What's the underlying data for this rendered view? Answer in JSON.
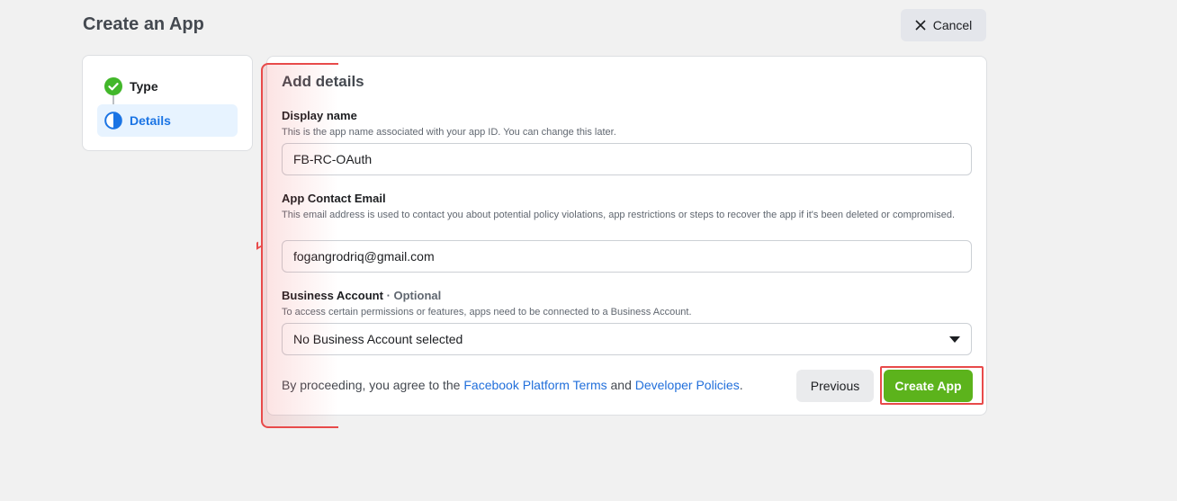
{
  "header": {
    "title": "Create an App",
    "cancel_label": "Cancel"
  },
  "steps": [
    {
      "label": "Type",
      "status": "complete",
      "icon": "check-circle-icon"
    },
    {
      "label": "Details",
      "status": "current",
      "icon": "half-circle-icon"
    }
  ],
  "form": {
    "title": "Add details",
    "display_name": {
      "label": "Display name",
      "help": "This is the app name associated with your app ID. You can change this later.",
      "value": "FB-RC-OAuth"
    },
    "contact_email": {
      "label": "App Contact Email",
      "help": "This email address is used to contact you about potential policy violations, app restrictions or steps to recover the app if it's been deleted or compromised.",
      "value": "fogangrodriq@gmail.com"
    },
    "business_account": {
      "label": "Business Account",
      "optional": "· Optional",
      "help": "To access certain permissions or features, apps need to be connected to a Business Account.",
      "value": "No Business Account selected"
    },
    "terms": {
      "prefix": "By proceeding, you agree to the ",
      "link1": "Facebook Platform Terms",
      "middle": " and ",
      "link2": "Developer Policies",
      "suffix": "."
    },
    "previous_label": "Previous",
    "create_label": "Create App"
  },
  "colors": {
    "accent_blue": "#1b74e4",
    "success_green": "#42b72a",
    "create_button": "#5cb31c",
    "highlight_red": "#e84a4a"
  }
}
